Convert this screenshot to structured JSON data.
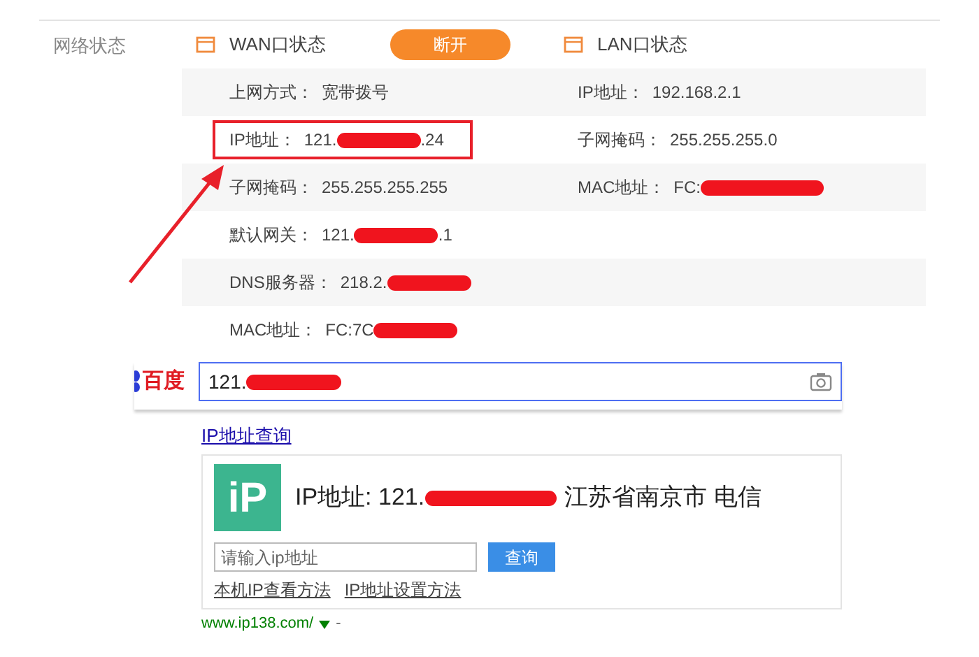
{
  "section_label": "网络状态",
  "wan": {
    "title": "WAN口状态",
    "button": "断开",
    "rows": [
      {
        "label": "上网方式：",
        "value": "宽带拨号",
        "redacted": false,
        "highlighted": false
      },
      {
        "label": "IP地址：",
        "value": "121.",
        "value_end": ".24",
        "redacted": true,
        "highlighted": true
      },
      {
        "label": "子网掩码：",
        "value": "255.255.255.255",
        "redacted": false,
        "highlighted": false
      },
      {
        "label": "默认网关：",
        "value": "121.",
        "value_end": ".1",
        "redacted": true,
        "highlighted": false
      },
      {
        "label": "DNS服务器：",
        "value": "218.2.",
        "redacted": true,
        "highlighted": false
      },
      {
        "label": "MAC地址：",
        "value": "FC:7C",
        "redacted": true,
        "highlighted": false
      }
    ]
  },
  "lan": {
    "title": "LAN口状态",
    "rows": [
      {
        "label": "IP地址：",
        "value": "192.168.2.1",
        "redacted": false
      },
      {
        "label": "子网掩码：",
        "value": "255.255.255.0",
        "redacted": false
      },
      {
        "label": "MAC地址：",
        "value": "FC:",
        "redacted": true
      }
    ]
  },
  "search": {
    "logo": "百度",
    "query": "121.",
    "redacted": true
  },
  "result": {
    "link": "IP地址查询",
    "icon_text": "iP",
    "headline": "IP地址: 121.",
    "redacted": true,
    "location": "江苏省南京市 电信",
    "placeholder": "请输入ip地址",
    "button": "查询",
    "links": [
      "本机IP查看方法",
      "IP地址设置方法"
    ],
    "url": "www.ip138.com/",
    "separator": "-"
  }
}
